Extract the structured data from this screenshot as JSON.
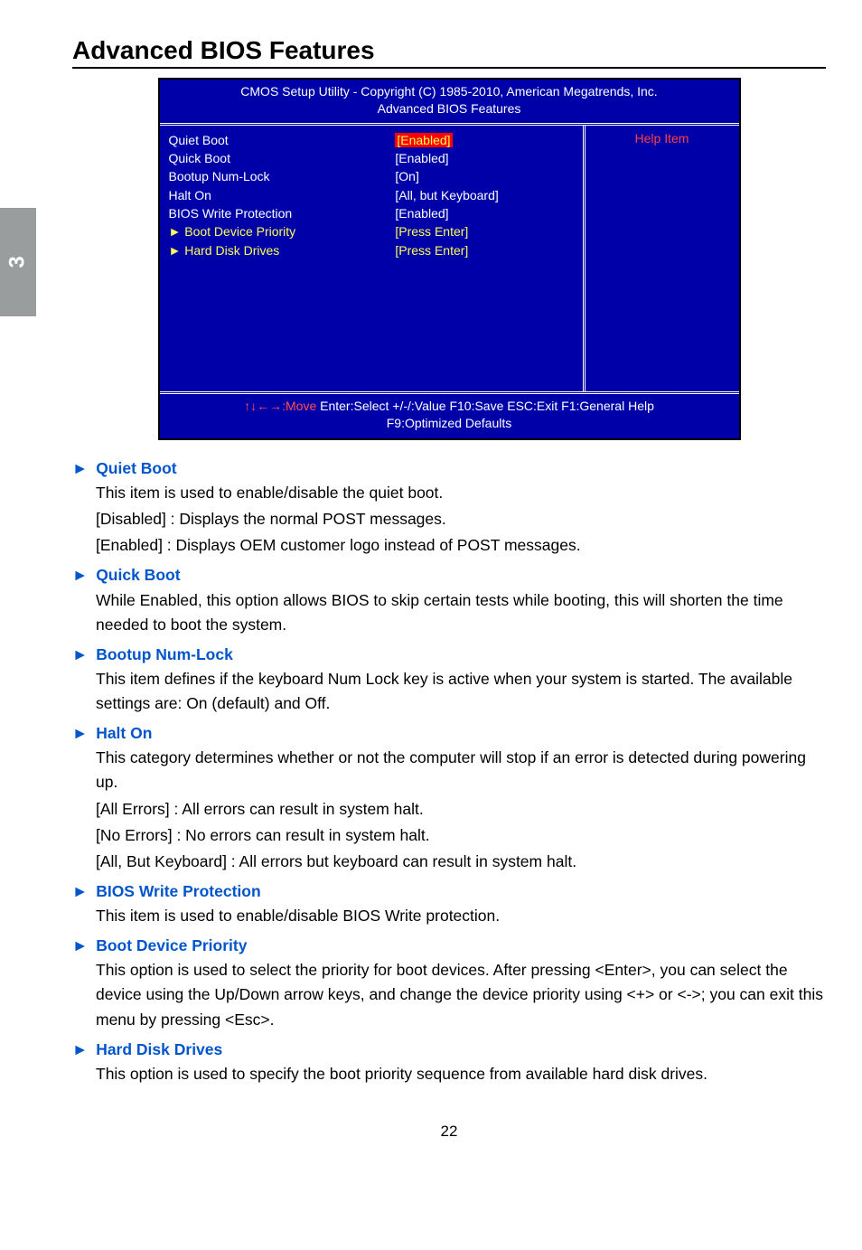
{
  "side_tab": "3",
  "main_title": "Advanced BIOS Features",
  "bios": {
    "header_line1": "CMOS Setup Utility - Copyright (C) 1985-2010, American Megatrends, Inc.",
    "header_line2": "Advanced BIOS Features",
    "rows": [
      {
        "label": "Quiet Boot",
        "value": "[Enabled]",
        "highlighted": true
      },
      {
        "label": "Quick Boot",
        "value": "[Enabled]"
      },
      {
        "label": "Bootup Num-Lock",
        "value": "[On]"
      },
      {
        "label": "Halt On",
        "value": "[All, but Keyboard]"
      },
      {
        "label": "BIOS Write Protection",
        "value": "[Enabled]"
      },
      {
        "label": "► Boot Device Priority",
        "value": "[Press Enter]",
        "yellow": true
      },
      {
        "label": "► Hard Disk Drives",
        "value": "[Press Enter]",
        "yellow": true
      }
    ],
    "help_title": "Help Item",
    "footer_line1_pre": "↑↓←→:Move",
    "footer_line1_rest": "   Enter:Select    +/-/:Value    F10:Save    ESC:Exit    F1:General Help",
    "footer_line2": "F9:Optimized Defaults"
  },
  "sections": [
    {
      "title": "Quiet Boot",
      "paras": [
        "This item is used to enable/disable the quiet boot.",
        "[Disabled] : Displays the normal POST messages.",
        "[Enabled] : Displays OEM customer logo instead of POST messages."
      ]
    },
    {
      "title": "Quick Boot",
      "paras": [
        "While Enabled, this option allows BIOS to skip certain tests while booting, this will shorten the time needed to boot the system."
      ]
    },
    {
      "title": "Bootup Num-Lock",
      "paras": [
        "This item defines if the keyboard Num Lock key is active when your system is started. The available settings are: On (default) and Off."
      ]
    },
    {
      "title": "Halt On",
      "paras": [
        "This category determines whether or not the computer will stop if an error is detected during powering up.",
        "[All Errors] : All errors can result in system halt.",
        "[No Errors] : No errors can result in system halt.",
        "[All, But Keyboard] : All errors but keyboard can result in system halt."
      ]
    },
    {
      "title": "BIOS Write Protection",
      "paras": [
        "This item is used to enable/disable BIOS Write protection."
      ]
    },
    {
      "title": "Boot Device Priority",
      "paras": [
        "This option is used to select the priority for boot devices. After pressing <Enter>, you can select the device using the Up/Down arrow keys, and change the device priority using <+> or <->; you can exit this menu by pressing <Esc>."
      ]
    },
    {
      "title": "Hard Disk Drives",
      "paras": [
        "This option is used to specify the boot priority sequence from available hard disk drives."
      ]
    }
  ],
  "page_number": "22"
}
